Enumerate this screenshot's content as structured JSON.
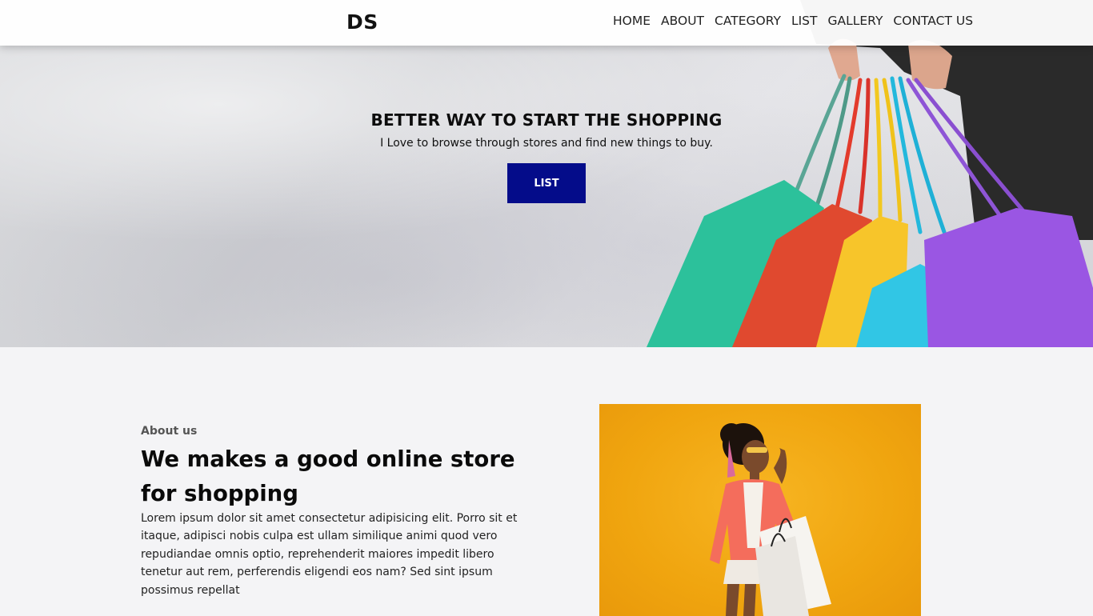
{
  "brand": {
    "logo": "DS"
  },
  "nav": {
    "items": [
      {
        "label": "HOME"
      },
      {
        "label": "ABOUT"
      },
      {
        "label": "CATEGORY"
      },
      {
        "label": "LIST"
      },
      {
        "label": "GALLERY"
      },
      {
        "label": "CONTACT US"
      }
    ]
  },
  "hero": {
    "title": "BETTER WAY TO START THE SHOPPING",
    "subtitle": "I Love to browse through stores and find new things to buy.",
    "button_label": "LIST",
    "button_color": "#040c8a"
  },
  "about": {
    "label": "About us",
    "title": "We makes a good online store for shopping",
    "text": "Lorem ipsum dolor sit amet consectetur adipisicing elit. Porro sit et itaque, adipisci nobis culpa est ullam similique animi quod vero repudiandae omnis optio, reprehenderit maiores impedit libero tenetur aut rem, perferendis eligendi eos nam? Sed sint ipsum possimus repellat",
    "image_background": "#f2a812"
  }
}
